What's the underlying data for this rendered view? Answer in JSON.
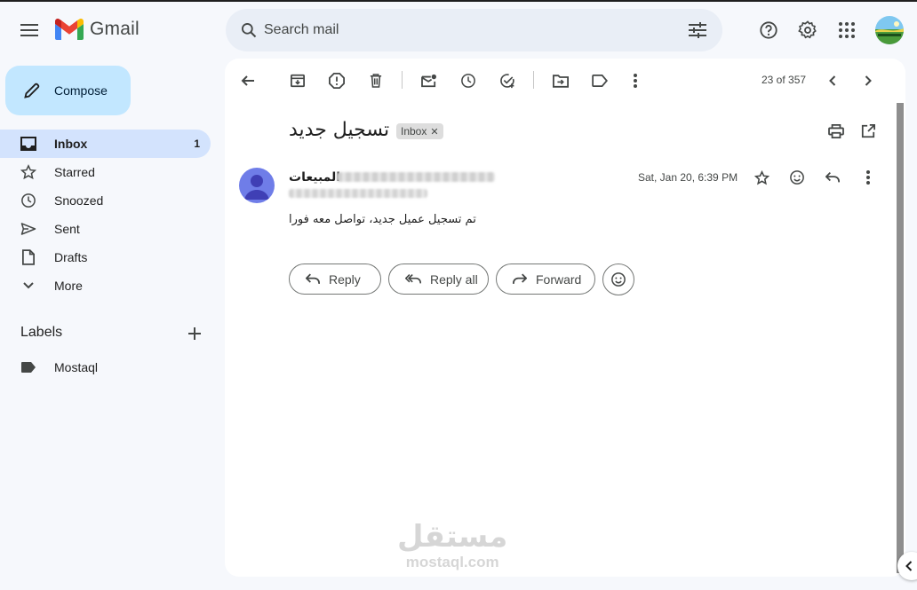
{
  "app": {
    "name": "Gmail"
  },
  "search": {
    "placeholder": "Search mail"
  },
  "sidebar": {
    "compose_label": "Compose",
    "items": [
      {
        "label": "Inbox",
        "count": "1",
        "icon": "inbox-icon"
      },
      {
        "label": "Starred",
        "count": "",
        "icon": "star-icon"
      },
      {
        "label": "Snoozed",
        "count": "",
        "icon": "clock-icon"
      },
      {
        "label": "Sent",
        "count": "",
        "icon": "send-icon"
      },
      {
        "label": "Drafts",
        "count": "",
        "icon": "draft-icon"
      },
      {
        "label": "More",
        "count": "",
        "icon": "chevron-down-icon"
      }
    ],
    "labels_title": "Labels",
    "labels": [
      {
        "label": "Mostaql",
        "icon": "label-icon"
      }
    ]
  },
  "toolbar": {
    "pager": "23 of 357"
  },
  "message": {
    "subject": "تسجيل جديد",
    "chip": "Inbox",
    "sender_name": "المبيعات",
    "date": "Sat, Jan 20, 6:39 PM",
    "body": "تم تسجيل عميل جديد، تواصل معه فورا"
  },
  "actions": {
    "reply": "Reply",
    "reply_all": "Reply all",
    "forward": "Forward"
  },
  "watermark": {
    "arabic": "مستقل",
    "latin": "mostaql.com"
  },
  "colors": {
    "accent": "#c2e7ff",
    "active_nav": "#d3e3fd",
    "background": "#f6f8fc",
    "avatar": "#6f7de8"
  }
}
